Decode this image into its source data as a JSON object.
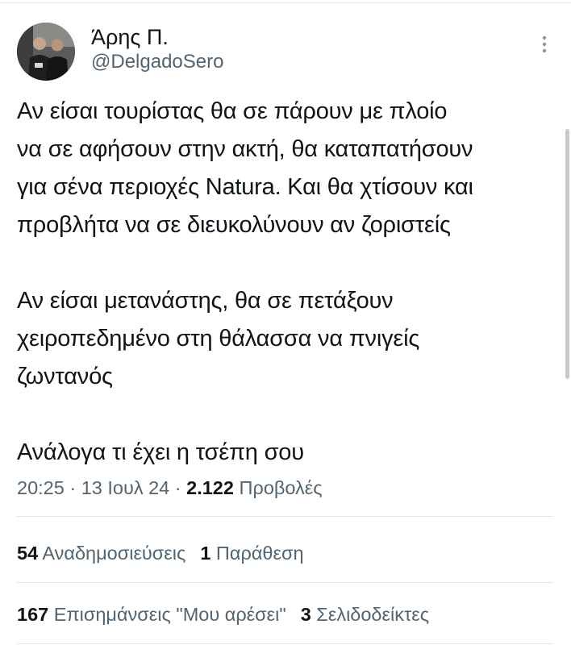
{
  "user": {
    "display_name": "Άρης Π.",
    "handle": "@DelgadoSero"
  },
  "icons": {
    "more": "more-vertical-icon",
    "avatar": "avatar-photo"
  },
  "tweet": {
    "text": "Αν είσαι τουρίστας θα σε πάρουν με πλοίο\nνα σε αφήσουν στην ακτή, θα καταπατήσουν\nγια σένα περιοχές Natura. Και θα χτίσουν και\nπροβλήτα να σε διευκολύνουν αν ζοριστείς\n\nΑν είσαι μετανάστης, θα σε πετάξουν\nχειροπεδημένο στη θάλασσα να πνιγείς\nζωντανός\n\nΑνάλογα τι έχει η τσέπη σου"
  },
  "meta": {
    "time": "20:25",
    "sep1": " · ",
    "date": "13 Ιουλ 24",
    "sep2": " · ",
    "views_count": "2.122",
    "views_label": " Προβολές"
  },
  "stats": {
    "reposts_count": "54",
    "reposts_label": " Αναδημοσιεύσεις",
    "quotes_count": "1",
    "quotes_label": " Παράθεση",
    "likes_count": "167",
    "likes_label": " Επισημάνσεις \"Μου αρέσει\"",
    "bookmarks_count": "3",
    "bookmarks_label": " Σελιδοδείκτες"
  },
  "colors": {
    "text_primary": "#0f1419",
    "text_secondary": "#536471",
    "divider": "#e3e6e9"
  }
}
